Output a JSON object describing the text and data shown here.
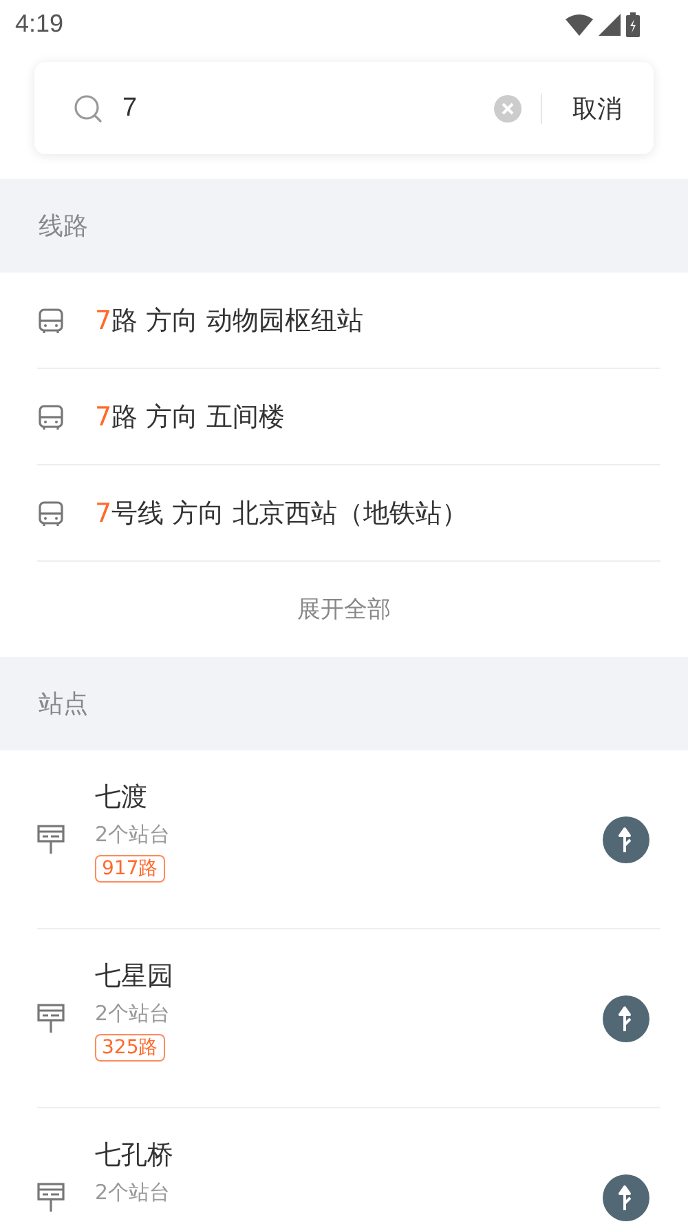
{
  "status_bar": {
    "time": "4:19"
  },
  "search": {
    "value": "7",
    "cancel": "取消"
  },
  "lines_section": {
    "title": "线路",
    "items": [
      {
        "match": "7",
        "rest": "路 方向 动物园枢纽站"
      },
      {
        "match": "7",
        "rest": "路 方向 五间楼"
      },
      {
        "match": "7",
        "rest": "号线 方向 北京西站（地铁站）"
      }
    ],
    "expand": "展开全部"
  },
  "stations_section": {
    "title": "站点",
    "items": [
      {
        "name": "七渡",
        "platforms": "2个站台",
        "tags": [
          "917路"
        ]
      },
      {
        "name": "七星园",
        "platforms": "2个站台",
        "tags": [
          "325路"
        ]
      },
      {
        "name": "七孔桥",
        "platforms": "2个站台"
      }
    ]
  }
}
